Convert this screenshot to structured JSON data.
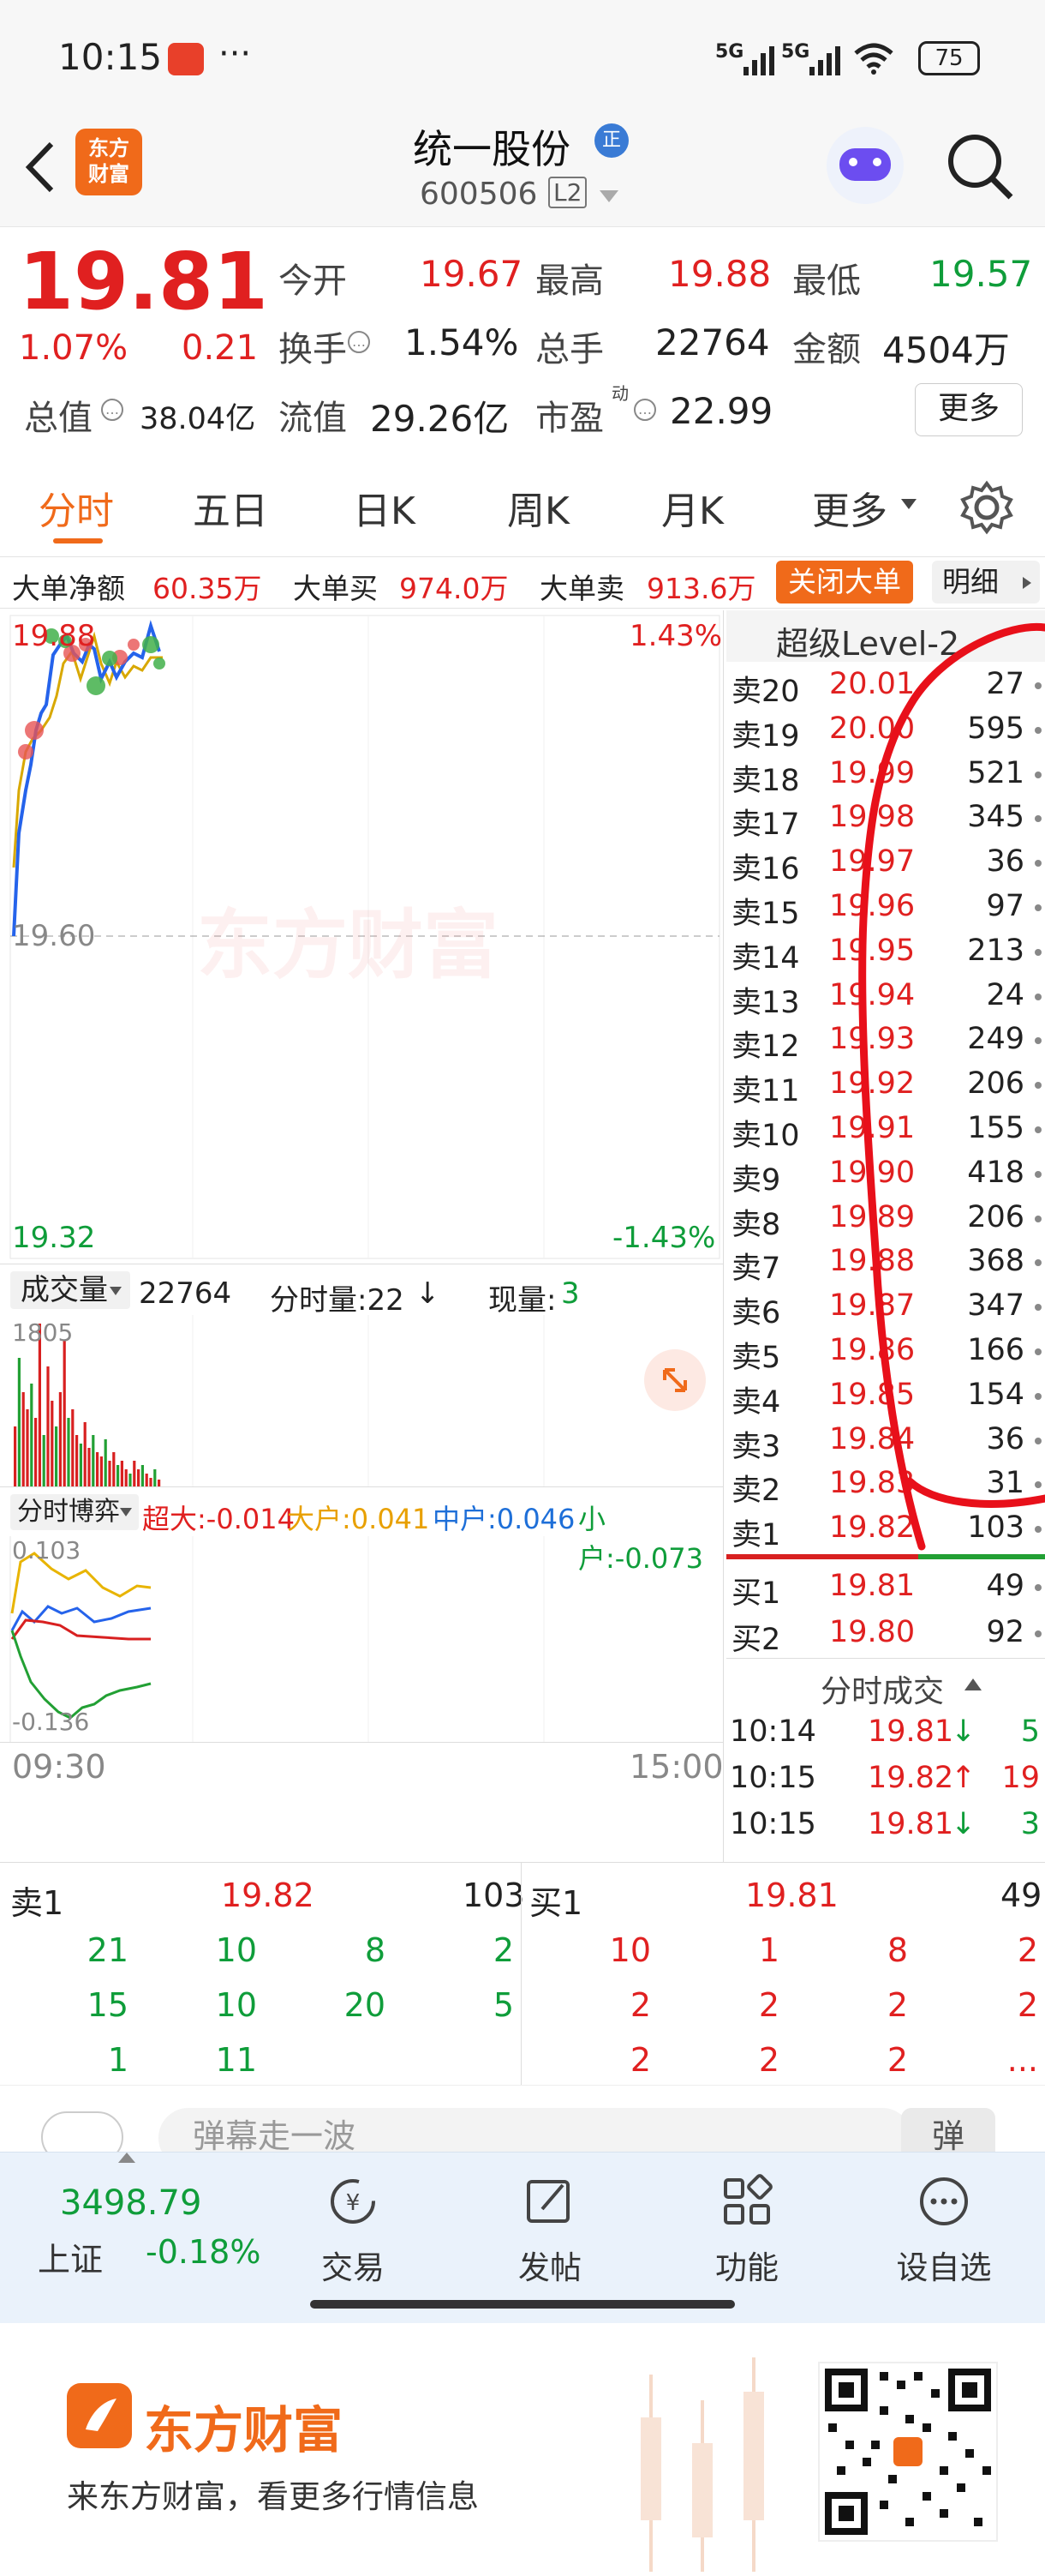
{
  "status_bar": {
    "time": "10:15",
    "dots": "···",
    "signal1": "5G",
    "signal2": "5G",
    "battery": "75"
  },
  "header": {
    "brand_logo": "东方\n财富",
    "stock_name": "统一股份",
    "badge": "正",
    "code": "600506",
    "level": "L2"
  },
  "quote": {
    "price": "19.81",
    "pct": "1.07%",
    "change": "0.21",
    "open_label": "今开",
    "open": "19.67",
    "high_label": "最高",
    "high": "19.88",
    "low_label": "最低",
    "low": "19.57",
    "turnover_label": "换手",
    "turnover": "1.54%",
    "volume_label": "总手",
    "volume": "22764",
    "amount_label": "金额",
    "amount": "4504万",
    "mktcap_label": "总值",
    "mktcap": "38.04亿",
    "float_label": "流值",
    "float": "29.26亿",
    "pe_label": "市盈",
    "pe_sup": "动",
    "pe": "22.99",
    "more_button": "更多"
  },
  "tabs": [
    "分时",
    "五日",
    "日K",
    "周K",
    "月K",
    "更多"
  ],
  "bigorder": {
    "net_label": "大单净额",
    "net": "60.35万",
    "buy_label": "大单买",
    "buy": "974.0万",
    "sell_label": "大单卖",
    "sell": "913.6万",
    "close_button": "关闭大单",
    "detail_button": "明细"
  },
  "chart": {
    "price_high": "19.88",
    "pct_high": "1.43%",
    "price_mid": "19.60",
    "price_low": "19.32",
    "pct_low": "-1.43%",
    "vol_label": "成交量",
    "vol_value": "22764",
    "split_label": "分时量:22",
    "split_arrow": "↓",
    "now_label": "现量:",
    "now_value": "3",
    "vol_max": "1805",
    "game_label": "分时博弈",
    "super_label": "超大:-0.014",
    "big_label": "大户:0.041",
    "mid_label": "中户:0.046",
    "small_label": "小户:-0.073",
    "game_max": "0.103",
    "game_min": "-0.136",
    "time_start": "09:30",
    "time_end": "15:00",
    "watermark": "东方财富"
  },
  "orderbook": {
    "title": "超级Level-2",
    "sells": [
      {
        "label": "卖20",
        "price": "20.01",
        "vol": "27"
      },
      {
        "label": "卖19",
        "price": "20.00",
        "vol": "595"
      },
      {
        "label": "卖18",
        "price": "19.99",
        "vol": "521"
      },
      {
        "label": "卖17",
        "price": "19.98",
        "vol": "345"
      },
      {
        "label": "卖16",
        "price": "19.97",
        "vol": "36"
      },
      {
        "label": "卖15",
        "price": "19.96",
        "vol": "97"
      },
      {
        "label": "卖14",
        "price": "19.95",
        "vol": "213"
      },
      {
        "label": "卖13",
        "price": "19.94",
        "vol": "24"
      },
      {
        "label": "卖12",
        "price": "19.93",
        "vol": "249"
      },
      {
        "label": "卖11",
        "price": "19.92",
        "vol": "206"
      },
      {
        "label": "卖10",
        "price": "19.91",
        "vol": "155"
      },
      {
        "label": "卖9",
        "price": "19.90",
        "vol": "418"
      },
      {
        "label": "卖8",
        "price": "19.89",
        "vol": "206"
      },
      {
        "label": "卖7",
        "price": "19.88",
        "vol": "368"
      },
      {
        "label": "卖6",
        "price": "19.87",
        "vol": "347"
      },
      {
        "label": "卖5",
        "price": "19.86",
        "vol": "166"
      },
      {
        "label": "卖4",
        "price": "19.85",
        "vol": "154"
      },
      {
        "label": "卖3",
        "price": "19.84",
        "vol": "36"
      },
      {
        "label": "卖2",
        "price": "19.83",
        "vol": "31"
      },
      {
        "label": "卖1",
        "price": "19.82",
        "vol": "103"
      }
    ],
    "buys": [
      {
        "label": "买1",
        "price": "19.81",
        "vol": "49"
      },
      {
        "label": "买2",
        "price": "19.80",
        "vol": "92"
      }
    ],
    "ticks_title": "分时成交",
    "ticks": [
      {
        "time": "10:14",
        "price": "19.81",
        "arrow": "↓",
        "vol": "5"
      },
      {
        "time": "10:15",
        "price": "19.82",
        "arrow": "↑",
        "vol": "19"
      },
      {
        "time": "10:15",
        "price": "19.81",
        "arrow": "↓",
        "vol": "3"
      }
    ]
  },
  "queue": {
    "sell_label": "卖1",
    "sell_price": "19.82",
    "sell_total": "103",
    "buy_label": "买1",
    "buy_price": "19.81",
    "buy_total": "49",
    "sell_rows": [
      [
        "21",
        "10",
        "8",
        "2"
      ],
      [
        "15",
        "10",
        "20",
        "5"
      ],
      [
        "1",
        "11",
        "",
        ""
      ]
    ],
    "buy_rows": [
      [
        "10",
        "1",
        "8",
        "2"
      ],
      [
        "2",
        "2",
        "2",
        "2"
      ],
      [
        "2",
        "2",
        "2",
        "..."
      ]
    ]
  },
  "danmu": {
    "placeholder": "弹幕走一波",
    "button": "弹"
  },
  "bottom_nav": {
    "index_value": "3498.79",
    "index_name": "上证",
    "index_change": "-0.18%",
    "items": [
      "交易",
      "发帖",
      "功能",
      "设自选"
    ]
  },
  "footer": {
    "brand": "东方财富",
    "slogan": "来东方财富，看更多行情信息"
  },
  "colors": {
    "up": "#e02020",
    "down": "#0f9d3a",
    "accent": "#f06a1a",
    "annotation": "#e8101a"
  }
}
